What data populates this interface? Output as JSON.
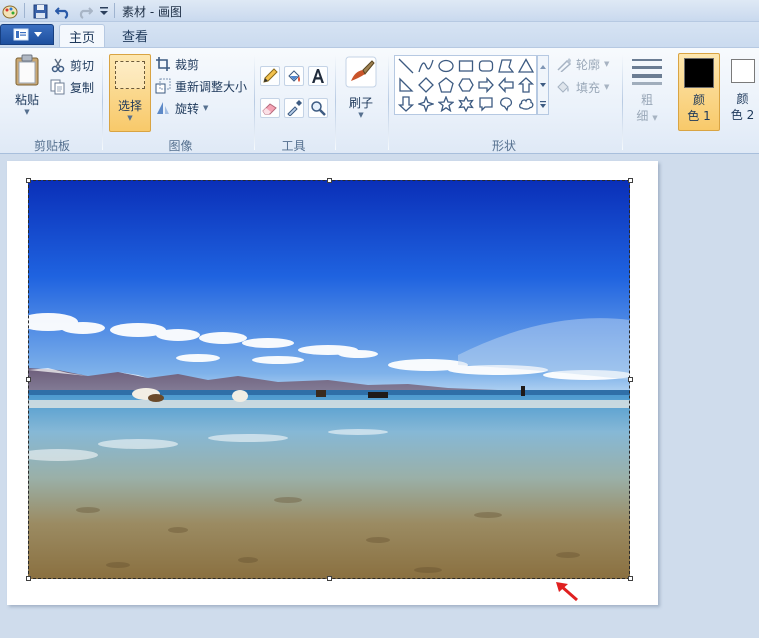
{
  "window": {
    "title": "素材 - 画图"
  },
  "tabs": [
    {
      "label": "主页"
    },
    {
      "label": "查看"
    }
  ],
  "clipboard": {
    "paste": "粘贴",
    "cut": "剪切",
    "copy": "复制",
    "group": "剪贴板"
  },
  "image": {
    "select": "选择",
    "crop": "裁剪",
    "resize": "重新调整大小",
    "rotate": "旋转",
    "group": "图像"
  },
  "tools": {
    "group": "工具"
  },
  "brushes": {
    "label": "刷子"
  },
  "shapes": {
    "outline": "轮廓",
    "fill": "填充",
    "group": "形状"
  },
  "size": {
    "label_line1": "粗",
    "label_line2": "细"
  },
  "colors": {
    "color1_line1": "颜",
    "color1_line2": "色 1",
    "color2_line1": "颜",
    "color2_line2": "色 2",
    "color1_value": "#000000",
    "color2_value": "#ffffff",
    "accent": "#f8c96a",
    "selection_annotation_arrow": "#e02020"
  },
  "icons": [
    "paint-menu-icon",
    "save-icon",
    "undo-icon",
    "redo-icon",
    "customize-dropdown-icon",
    "paste-icon",
    "cut-icon",
    "copy-icon",
    "select-icon",
    "crop-icon",
    "resize-icon",
    "rotate-icon",
    "pencil-icon",
    "fill-icon",
    "text-icon",
    "eraser-icon",
    "color-picker-icon",
    "magnifier-icon",
    "brush-icon",
    "outline-icon",
    "fill-shape-icon",
    "size-icon"
  ]
}
